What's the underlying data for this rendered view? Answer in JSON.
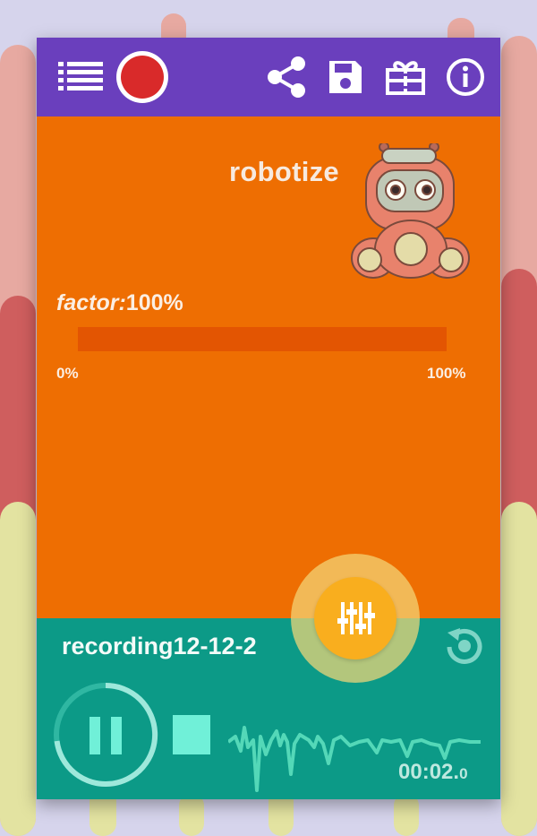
{
  "toolbar": {
    "icons": [
      "list-icon",
      "record-icon",
      "share-icon",
      "save-icon",
      "gift-icon",
      "info-icon"
    ],
    "record_color": "#d92a2a",
    "bar_color": "#6a3fbd"
  },
  "effect": {
    "title": "robotize",
    "factor_name": "factor:",
    "factor_value": "100%",
    "factor_level": 1.0,
    "min_label": "0%",
    "max_label": "100%",
    "background_color": "#ee6e02",
    "mascot": "robot-mascot-icon"
  },
  "player": {
    "recording_name": "recording12-12-2",
    "time_main": "00:02.",
    "time_fraction": "0",
    "background_color": "#0c9a87",
    "icons": [
      "pause-icon",
      "stop-icon",
      "waveform",
      "replay-icon",
      "equalizer-icon"
    ]
  }
}
